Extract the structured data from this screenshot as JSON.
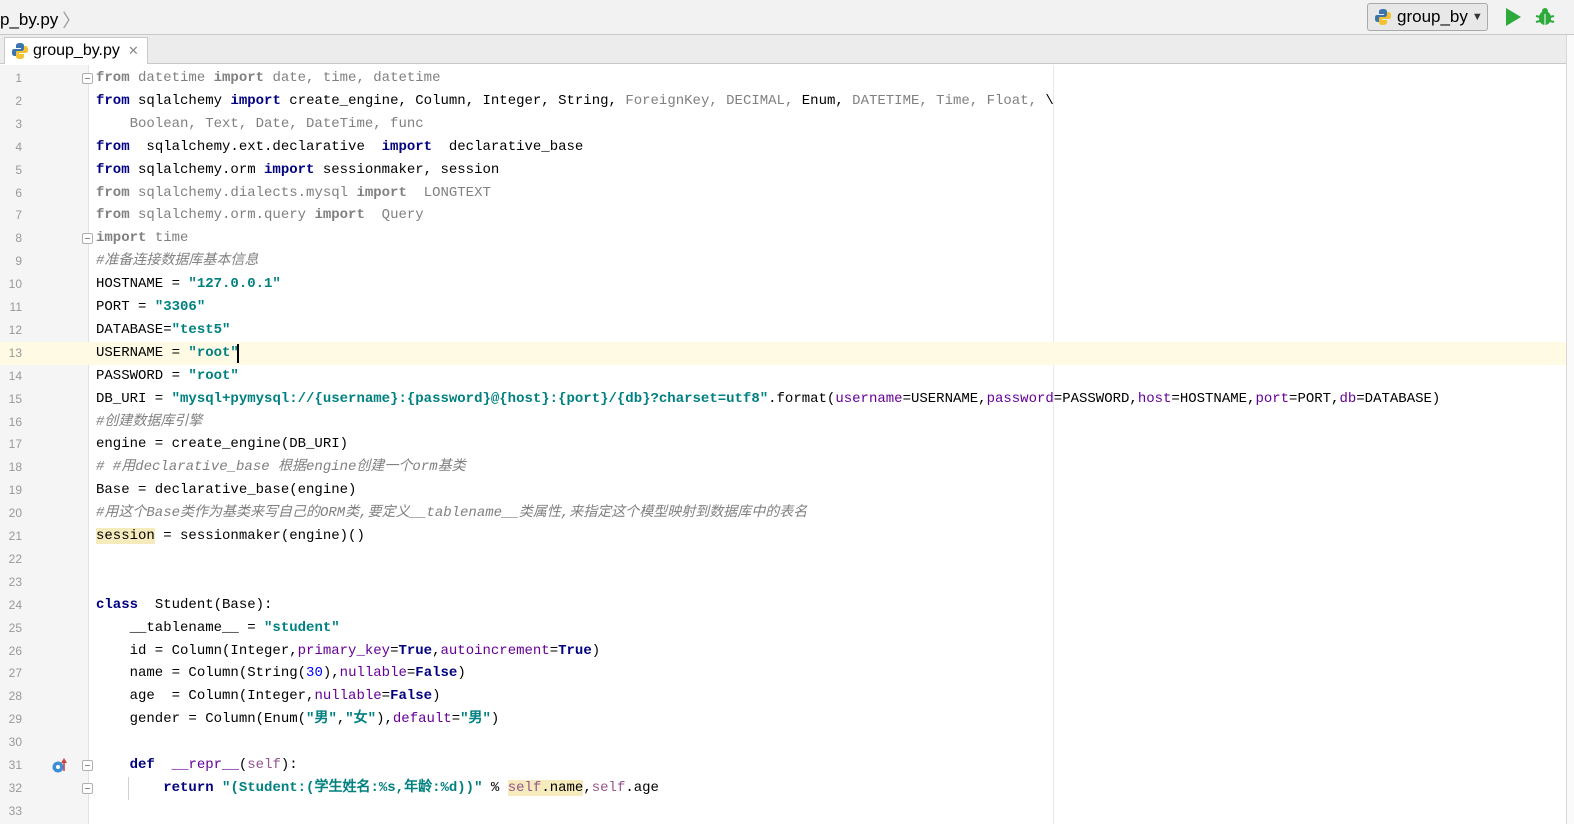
{
  "breadcrumb": {
    "file": "p_by.py"
  },
  "run_config": {
    "name": "group_by"
  },
  "tabs": [
    {
      "label": "group_by.py"
    }
  ],
  "icons": {
    "python": "python-file-icon",
    "run": "run-icon",
    "debug": "debug-icon",
    "close": "close-icon",
    "override": "override-method-icon"
  },
  "colors": {
    "keyword": "#000080",
    "string": "#008080",
    "comment": "#808080",
    "param": "#660099",
    "number": "#0000ff",
    "self": "#94558d",
    "current_line": "#fffae3",
    "run_green": "#2eaa3c"
  },
  "editor": {
    "current_line": 13,
    "lines": [
      {
        "n": "1",
        "html": "<span class=\"kw dim\">from</span><span class=\"dim\"> datetime </span><span class=\"kw dim\">import</span><span class=\"dim\"> date, time, datetime</span>"
      },
      {
        "n": "2",
        "html": "<span class=\"kw\">from</span> sqlalchemy <span class=\"kw\">import</span> create_engine, Column, Integer, String, <span class=\"dim\">ForeignKey, DECIMAL,</span> Enum, <span class=\"dim\">DATETIME, Time, Float,</span> \\"
      },
      {
        "n": "3",
        "html": "<span class=\"dim\">    Boolean, Text, Date, DateTime, func</span>"
      },
      {
        "n": "4",
        "html": "<span class=\"kw\">from</span>  sqlalchemy.ext.declarative  <span class=\"kw\">import</span>  declarative_base"
      },
      {
        "n": "5",
        "html": "<span class=\"kw\">from</span> sqlalchemy.orm <span class=\"kw\">import</span> sessionmaker, session"
      },
      {
        "n": "6",
        "html": "<span class=\"kw dim\">from</span><span class=\"dim\"> sqlalchemy.dialects.mysql </span><span class=\"kw dim\">import</span><span class=\"dim\">  LONGTEXT</span>"
      },
      {
        "n": "7",
        "html": "<span class=\"kw dim\">from</span><span class=\"dim\"> sqlalchemy.orm.query </span><span class=\"kw dim\">import</span><span class=\"dim\">  Query</span>"
      },
      {
        "n": "8",
        "html": "<span class=\"kw dim\">import</span><span class=\"dim\"> time</span>"
      },
      {
        "n": "9",
        "html": "<span class=\"cmt\">#准备连接数据库基本信息</span>"
      },
      {
        "n": "10",
        "html": "HOSTNAME = <span class=\"str\">\"127.0.0.1\"</span>"
      },
      {
        "n": "11",
        "html": "PORT = <span class=\"str\">\"3306\"</span>"
      },
      {
        "n": "12",
        "html": "DATABASE=<span class=\"str\">\"test5\"</span>"
      },
      {
        "n": "13",
        "html": "USERNAME = <span class=\"str\">\"root\"</span>"
      },
      {
        "n": "14",
        "html": "PASSWORD = <span class=\"str\">\"root\"</span>"
      },
      {
        "n": "15",
        "html": "DB_URI = <span class=\"str\">\"mysql+pymysql://{username}:{password}@{host}:{port}/{db}?charset=utf8\"</span>.format(<span class=\"param\">username</span>=USERNAME,<span class=\"param\">password</span>=PASSWORD,<span class=\"param\">host</span>=HOSTNAME,<span class=\"param\">port</span>=PORT,<span class=\"param\">db</span>=DATABASE)"
      },
      {
        "n": "16",
        "html": "<span class=\"cmt\">#创建数据库引擎</span>"
      },
      {
        "n": "17",
        "html": "engine = create_engine(DB_URI)"
      },
      {
        "n": "18",
        "html": "<span class=\"cmt\"># #用declarative_base 根据engine创建一个orm基类</span>"
      },
      {
        "n": "19",
        "html": "Base = declarative_base(engine)"
      },
      {
        "n": "20",
        "html": "<span class=\"cmt\">#用这个Base类作为基类来写自己的ORM类,要定义__tablename__类属性,来指定这个模型映射到数据库中的表名</span>"
      },
      {
        "n": "21",
        "html": "<span class=\"hl\">session</span> = sessionmaker(engine)()"
      },
      {
        "n": "22",
        "html": ""
      },
      {
        "n": "23",
        "html": ""
      },
      {
        "n": "24",
        "html": "<span class=\"kw\">class</span>  Student(Base):"
      },
      {
        "n": "25",
        "html": "    __tablename__ = <span class=\"str\">\"student\"</span>"
      },
      {
        "n": "26",
        "html": "    id = Column(Integer,<span class=\"param\">primary_key</span>=<span class=\"kw\">True</span>,<span class=\"param\">autoincrement</span>=<span class=\"kw\">True</span>)"
      },
      {
        "n": "27",
        "html": "    name = Column(String(<span class=\"num\">30</span>),<span class=\"param\">nullable</span>=<span class=\"kw\">False</span>)"
      },
      {
        "n": "28",
        "html": "    age  = Column(Integer,<span class=\"param\">nullable</span>=<span class=\"kw\">False</span>)"
      },
      {
        "n": "29",
        "html": "    gender = Column(Enum(<span class=\"str\">\"男\"</span>,<span class=\"str\">\"女\"</span>),<span class=\"param\">default</span>=<span class=\"str\">\"男\"</span>)"
      },
      {
        "n": "30",
        "html": ""
      },
      {
        "n": "31",
        "html": "    <span class=\"kw\">def</span>  <span class=\"param\">__repr__</span>(<span class=\"self\">self</span>):"
      },
      {
        "n": "32",
        "html": "        <span class=\"kw\">return</span> <span class=\"str\">\"(Student:(学生姓名:%s,年龄:%d))\"</span> % <span class=\"self hl\">self</span><span class=\"hl\">.name</span>,<span class=\"self\">self</span>.age"
      },
      {
        "n": "33",
        "html": ""
      }
    ]
  }
}
